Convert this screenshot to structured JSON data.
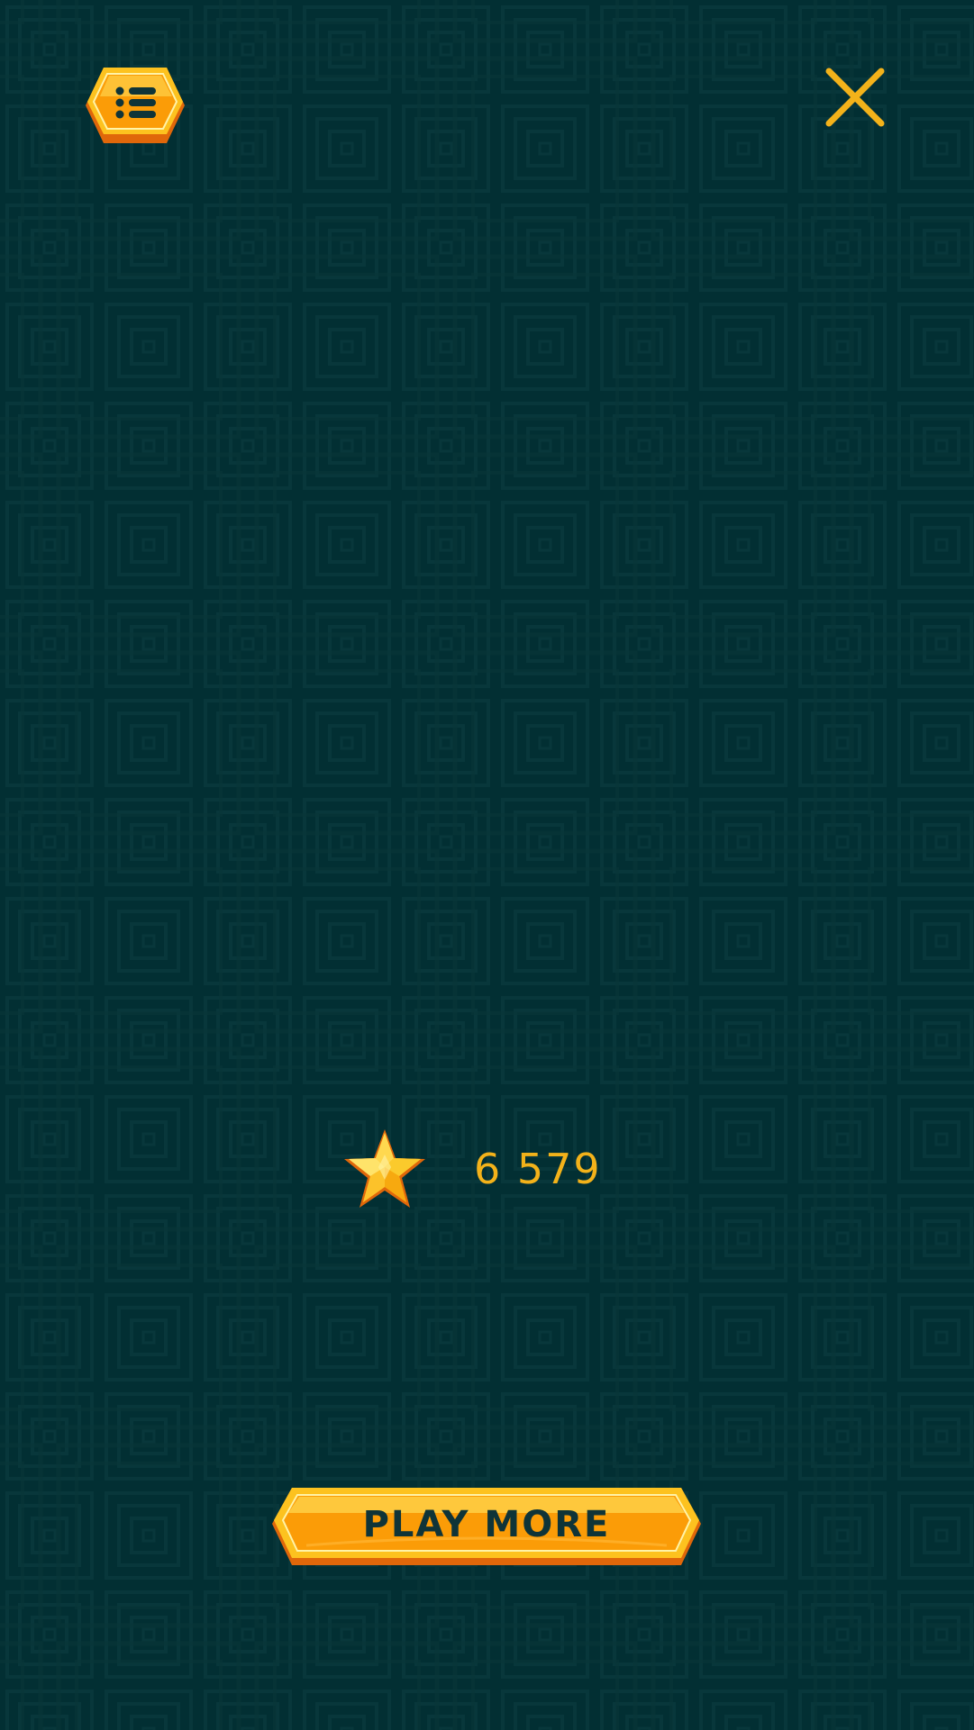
{
  "header": {
    "menu_button": {
      "icon": "list-icon"
    },
    "close_button": {
      "icon": "close-icon"
    }
  },
  "score": {
    "icon": "star-icon",
    "value": "6 579"
  },
  "actions": {
    "play_more_label": "PLAY MORE"
  },
  "colors": {
    "background": "#022f33",
    "pattern_line": "#0a3a3e",
    "accent_gold": "#f3b21a",
    "button_orange": "#fb9c07",
    "button_dark_orange": "#e0670a",
    "button_text": "#0f3438"
  }
}
